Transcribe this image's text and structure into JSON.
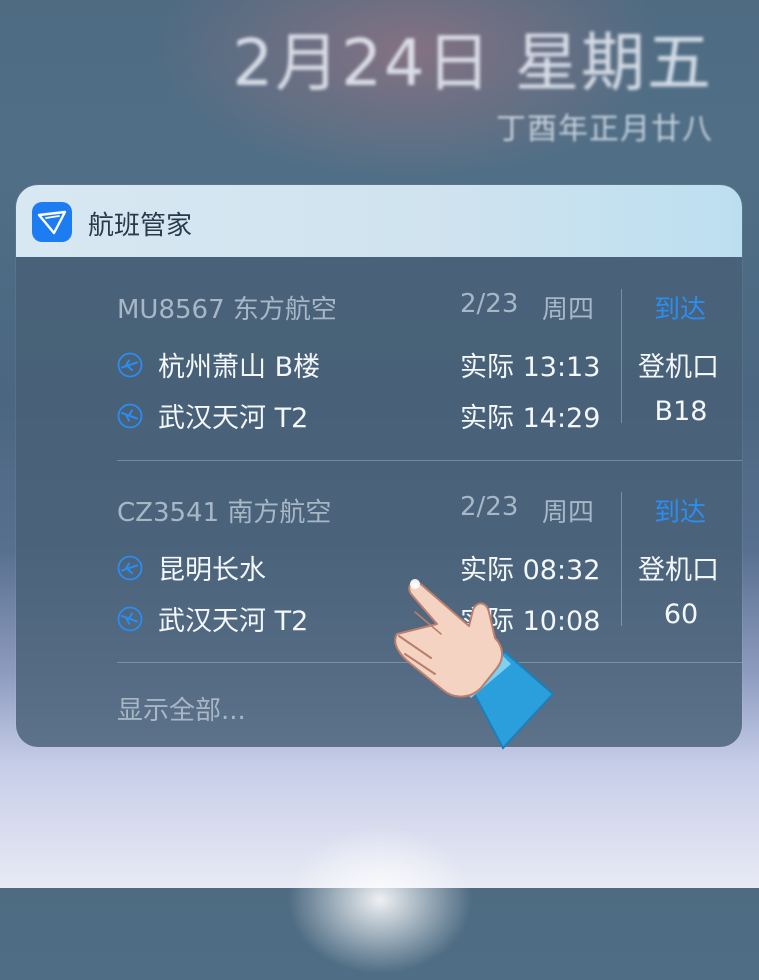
{
  "lockscreen": {
    "date": "2月24日 星期五",
    "lunar_date": "丁酉年正月廿八"
  },
  "widget": {
    "app_name": "航班管家",
    "flights": [
      {
        "airline": "MU8567 东方航空",
        "date": "2/23",
        "weekday": "周四",
        "status": "到达",
        "departure_airport": "杭州萧山 B楼",
        "departure_time": "实际 13:13",
        "arrival_airport": "武汉天河 T2",
        "arrival_time": "实际 14:29",
        "gate_label": "登机口",
        "gate": "B18"
      },
      {
        "airline": "CZ3541 南方航空",
        "date": "2/23",
        "weekday": "周四",
        "status": "到达",
        "departure_airport": "昆明长水",
        "departure_time": "实际 08:32",
        "arrival_airport": "武汉天河 T2",
        "arrival_time": "实际 10:08",
        "gate_label": "登机口",
        "gate": "60"
      }
    ],
    "show_all": "显示全部..."
  },
  "colors": {
    "accent": "#2b8df0",
    "app_icon": "#1d7cf2"
  },
  "icons": [
    "app-icon",
    "takeoff-icon",
    "landing-icon",
    "pointing-hand-icon"
  ]
}
